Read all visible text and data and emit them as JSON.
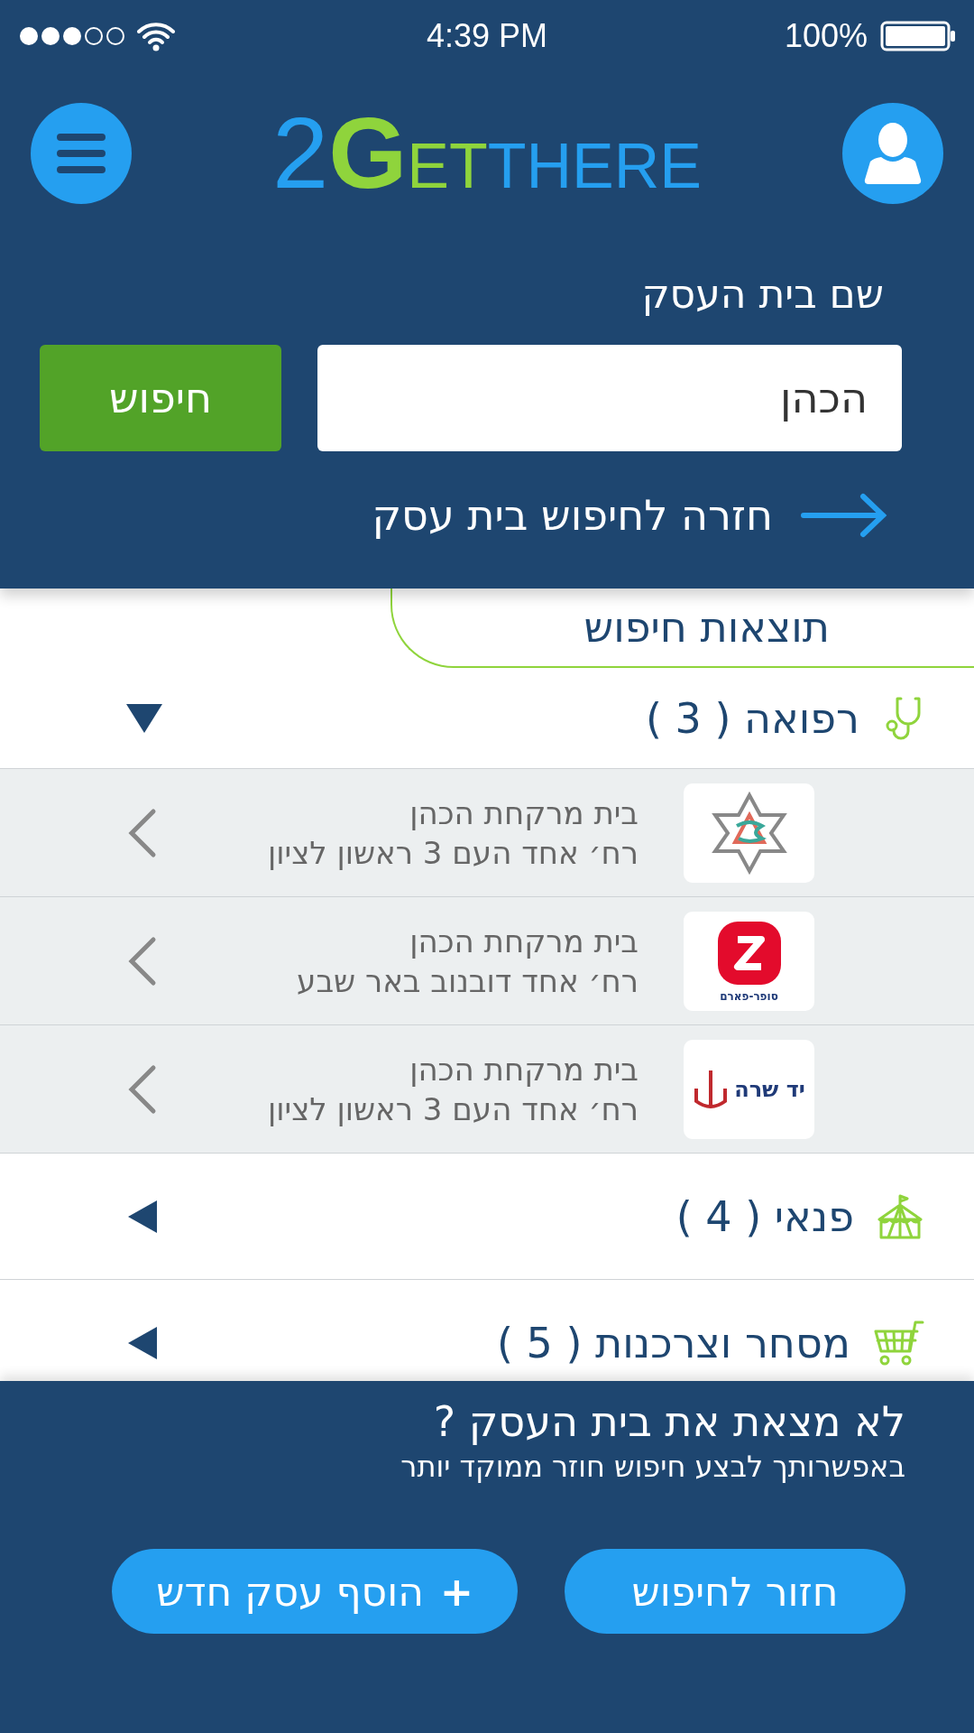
{
  "status_bar": {
    "time": "4:39 PM",
    "battery": "100%"
  },
  "header": {
    "logo": {
      "digit": "2",
      "initial": "G",
      "middle": "ET",
      "end": "THERE"
    }
  },
  "search": {
    "label": "שם בית העסק",
    "value": "הכהן",
    "button": "חיפוש",
    "back_link": "חזרה לחיפוש בית עסק"
  },
  "results_title": "תוצאות חיפוש",
  "categories": [
    {
      "name": "רפואה",
      "count": "( 3 )",
      "kind": "stethoscope",
      "expanded": true,
      "items": [
        {
          "name": "בית מרקחת הכהן",
          "address": "רח׳  אחד העם 3  ראשון לציון",
          "logo": {
            "kind": "star"
          }
        },
        {
          "name": "בית מרקחת הכהן",
          "address": "רח׳  אחד דובנוב באר שבע",
          "logo": {
            "kind": "superpharm",
            "text": "סופר-פארם"
          }
        },
        {
          "name": "בית מרקחת הכהן",
          "address": "רח׳  אחד העם 3  ראשון לציון",
          "logo": {
            "kind": "yadsarah",
            "text": "יד שרה"
          }
        }
      ]
    },
    {
      "name": "פנאי",
      "count": "( 4 )",
      "kind": "tent",
      "expanded": false
    },
    {
      "name": "מסחר וצרכנות",
      "count": "( 5 )",
      "kind": "cart",
      "expanded": false
    }
  ],
  "footer": {
    "title": "לא מצאת את בית העסק ?",
    "subtitle": "באפשרותך לבצע חיפוש חוזר ממוקד יותר",
    "buttons": [
      {
        "label": "חזור לחיפוש",
        "kind": "back"
      },
      {
        "label": "הוסף עסק חדש",
        "kind": "add",
        "prefix": "+"
      }
    ]
  }
}
